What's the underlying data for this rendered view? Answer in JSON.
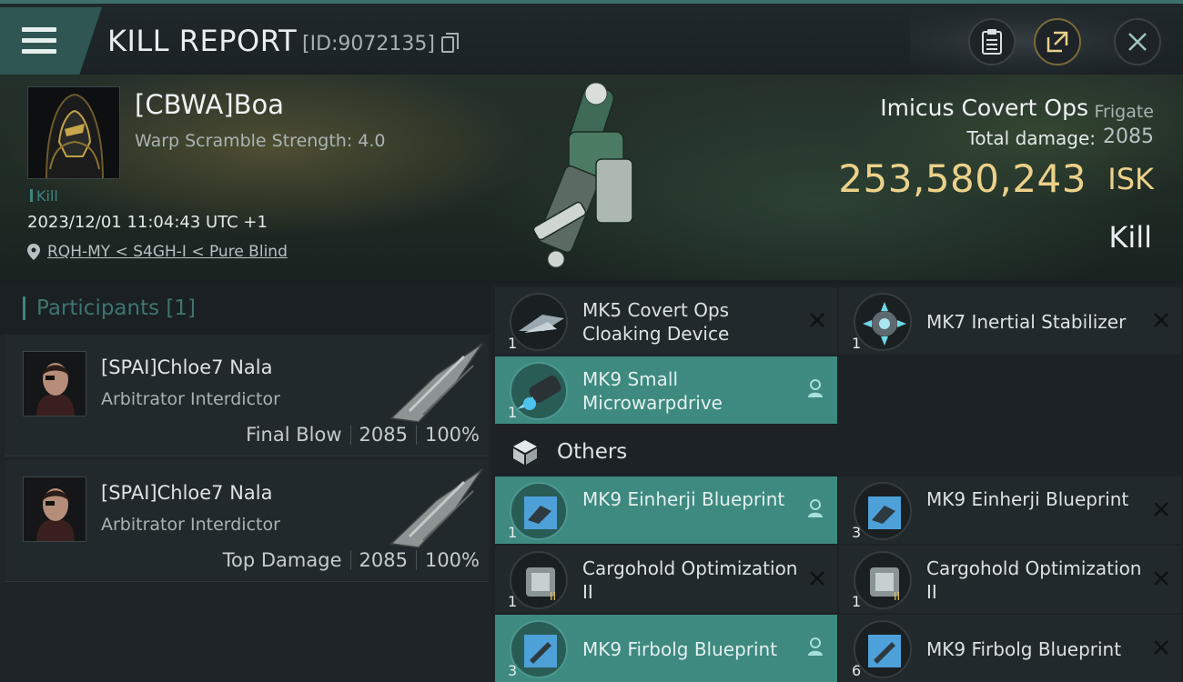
{
  "header": {
    "title": "KILL REPORT",
    "report_id": "[ID:9072135]"
  },
  "victim": {
    "pilot_name": "[CBWA]Boa",
    "warp_scramble": "Warp Scramble Strength: 4.0",
    "kill_tag": "Kill",
    "datetime": "2023/12/01 11:04:43 UTC +1",
    "location": "RQH-MY < S4GH-I < Pure Blind",
    "ship_name": "Imicus Covert Ops",
    "ship_class": "Frigate",
    "total_damage_label": "Total damage:",
    "total_damage_value": "2085",
    "isk_value": "253,580,243",
    "isk_unit": "ISK",
    "result": "Kill"
  },
  "participants": {
    "title": "Participants [1]",
    "rows": [
      {
        "name": "[SPAI]Chloe7 Nala",
        "ship": "Arbitrator Interdictor",
        "role": "Final Blow",
        "damage": "2085",
        "percent": "100%"
      },
      {
        "name": "[SPAI]Chloe7 Nala",
        "ship": "Arbitrator Interdictor",
        "role": "Top Damage",
        "damage": "2085",
        "percent": "100%"
      }
    ]
  },
  "items": {
    "fitted": [
      {
        "qty": "1",
        "name": "MK5 Covert Ops Cloaking Device",
        "status": "destroyed"
      },
      {
        "qty": "1",
        "name": "MK7 Inertial Stabilizer",
        "status": "destroyed"
      },
      {
        "qty": "1",
        "name": "MK9 Small Microwarpdrive",
        "status": "dropped"
      }
    ],
    "others_label": "Others",
    "others": [
      {
        "qty": "1",
        "name": "MK9 Einherji Blueprint",
        "status": "dropped"
      },
      {
        "qty": "3",
        "name": "MK9 Einherji Blueprint",
        "status": "destroyed"
      },
      {
        "qty": "1",
        "name": "Cargohold Optimization II",
        "status": "destroyed"
      },
      {
        "qty": "1",
        "name": "Cargohold Optimization II",
        "status": "destroyed"
      },
      {
        "qty": "3",
        "name": "MK9 Firbolg Blueprint",
        "status": "dropped"
      },
      {
        "qty": "6",
        "name": "MK9 Firbolg Blueprint",
        "status": "destroyed"
      }
    ]
  },
  "colors": {
    "accent": "#3f8580",
    "highlight_row": "#3e8a80",
    "isk_gold": "#ecd18a"
  },
  "icons": [
    "menu-icon",
    "copy-icon",
    "clipboard-icon",
    "share-icon",
    "close-icon",
    "location-pin-icon",
    "cube-icon",
    "x-icon",
    "user-icon"
  ]
}
